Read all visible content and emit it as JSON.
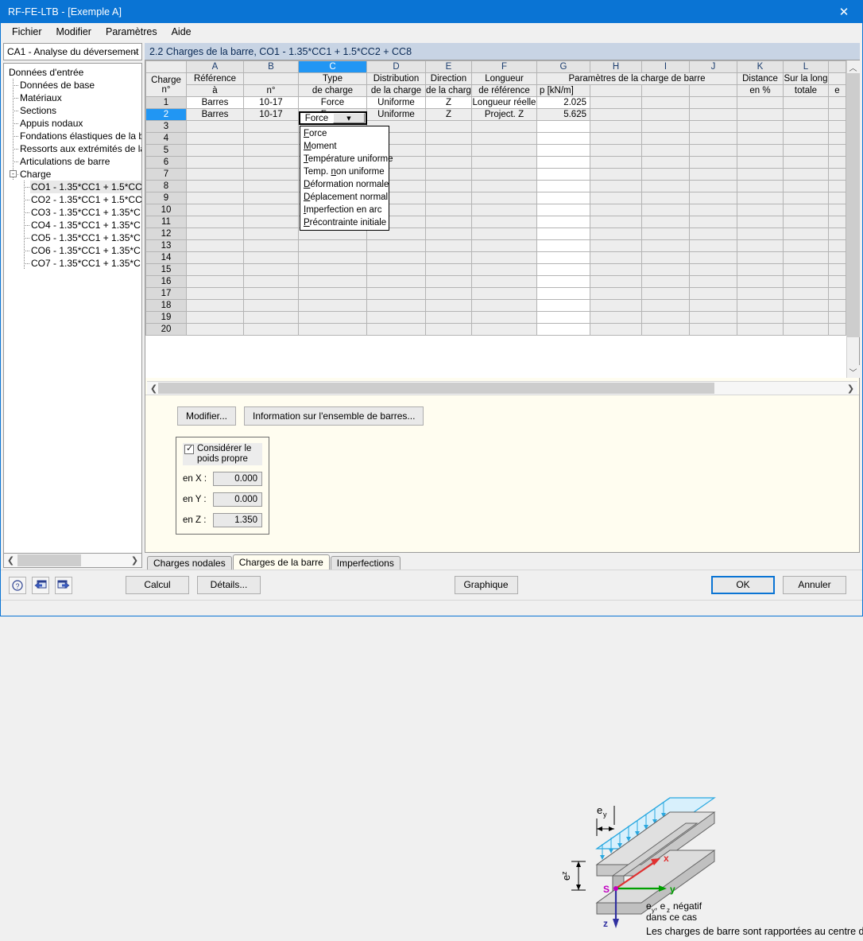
{
  "window": {
    "title": "RF-FE-LTB - [Exemple A]",
    "close_icon": "close-icon"
  },
  "menubar": {
    "items": [
      "Fichier",
      "Modifier",
      "Paramètres",
      "Aide"
    ]
  },
  "sidebar": {
    "combo_value": "CA1 - Analyse du déversement",
    "tree": [
      {
        "label": "Données d'entrée",
        "level": 0
      },
      {
        "label": "Données de base",
        "level": 1
      },
      {
        "label": "Matériaux",
        "level": 1
      },
      {
        "label": "Sections",
        "level": 1
      },
      {
        "label": "Appuis nodaux",
        "level": 1
      },
      {
        "label": "Fondations élastiques de la bar",
        "level": 1
      },
      {
        "label": "Ressorts aux extrémités de la b",
        "level": 1
      },
      {
        "label": "Articulations de barre",
        "level": 1
      },
      {
        "label": "Charge",
        "level": 1,
        "expander": "-"
      },
      {
        "label": "CO1 - 1.35*CC1 + 1.5*CC",
        "level": 2,
        "selected": true
      },
      {
        "label": "CO2 - 1.35*CC1 + 1.5*CC",
        "level": 2
      },
      {
        "label": "CO3 - 1.35*CC1 + 1.35*C",
        "level": 2
      },
      {
        "label": "CO4 - 1.35*CC1 + 1.35*C",
        "level": 2
      },
      {
        "label": "CO5 - 1.35*CC1 + 1.35*C",
        "level": 2
      },
      {
        "label": "CO6 - 1.35*CC1 + 1.35*C",
        "level": 2
      },
      {
        "label": "CO7 - 1.35*CC1 + 1.35*C",
        "level": 2
      }
    ],
    "scroll_left_icon": "chevron-left-icon",
    "scroll_right_icon": "chevron-right-icon"
  },
  "panel": {
    "title": "2.2 Charges de la barre, CO1 - 1.35*CC1 + 1.5*CC2 + CC8"
  },
  "table": {
    "column_letters": [
      "A",
      "B",
      "C",
      "D",
      "E",
      "F",
      "G",
      "H",
      "I",
      "J",
      "K",
      "L"
    ],
    "active_column": "C",
    "row_header_label": "Charge n°",
    "headers": [
      {
        "line1": "Référence",
        "line2": "à"
      },
      {
        "line1": "",
        "line2": "n°"
      },
      {
        "line1": "Type",
        "line2": "de charge"
      },
      {
        "line1": "Distribution",
        "line2": "de la charge"
      },
      {
        "line1": "Direction",
        "line2": "de la charg"
      },
      {
        "line1": "Longueur",
        "line2": "de référence"
      }
    ],
    "group_header": "Paramètres de la charge de barre",
    "group_subheader": "p [kN/m]",
    "headers_right": [
      {
        "line1": "Distance",
        "line2": "en %"
      },
      {
        "line1": "Sur la long",
        "line2": "totale"
      },
      {
        "line1": "",
        "line2": "e"
      }
    ],
    "rows": [
      {
        "n": "1",
        "a": "Barres",
        "b": "10-17",
        "c": "Force",
        "d": "Uniforme",
        "e": "Z",
        "f": "Longueur réelle",
        "g": "2.025",
        "selected": false
      },
      {
        "n": "2",
        "a": "Barres",
        "b": "10-17",
        "c": "Force",
        "d": "Uniforme",
        "e": "Z",
        "f": "Project. Z",
        "g": "5.625",
        "selected": true
      },
      {
        "n": "3"
      },
      {
        "n": "4"
      },
      {
        "n": "5"
      },
      {
        "n": "6"
      },
      {
        "n": "7"
      },
      {
        "n": "8"
      },
      {
        "n": "9"
      },
      {
        "n": "10"
      },
      {
        "n": "11"
      },
      {
        "n": "12"
      },
      {
        "n": "13"
      },
      {
        "n": "14"
      },
      {
        "n": "15"
      },
      {
        "n": "16"
      },
      {
        "n": "17"
      },
      {
        "n": "18"
      },
      {
        "n": "19"
      },
      {
        "n": "20"
      }
    ],
    "scroll_up_icon": "chevron-up-icon",
    "scroll_down_icon": "chevron-down-icon",
    "hscroll_left_icon": "chevron-left-icon",
    "hscroll_right_icon": "chevron-right-icon"
  },
  "dropdown": {
    "selected": "Force",
    "open": true,
    "items": [
      {
        "pre": "",
        "acc": "F",
        "post": "orce"
      },
      {
        "pre": "",
        "acc": "M",
        "post": "oment"
      },
      {
        "pre": "",
        "acc": "T",
        "post": "empérature uniforme"
      },
      {
        "pre": "Temp. ",
        "acc": "n",
        "post": "on uniforme"
      },
      {
        "pre": "",
        "acc": "D",
        "post": "éformation normale"
      },
      {
        "pre": "",
        "acc": "D",
        "post": "éplacement normal"
      },
      {
        "pre": "",
        "acc": "I",
        "post": "mperfection en arc"
      },
      {
        "pre": "",
        "acc": "P",
        "post": "récontrainte initiale"
      }
    ]
  },
  "detail": {
    "buttons": [
      "Modifier...",
      "Information sur l'ensemble de barres..."
    ],
    "selfweight": {
      "checkbox_label_line1": "Considérer le",
      "checkbox_label_line2": "poids propre",
      "checked": true,
      "fields": [
        {
          "label": "en X :",
          "value": "0.000"
        },
        {
          "label": "en Y :",
          "value": "0.000"
        },
        {
          "label": "en Z :",
          "value": "1.350"
        }
      ]
    },
    "diagram": {
      "label_ey": "e",
      "label_ey_sub": "y",
      "label_ez": "e",
      "label_ez_sub": "z",
      "axis_x": "x",
      "axis_y": "y",
      "axis_z": "z",
      "origin": "S",
      "note_line1": "négatif",
      "note_line2": "dans ce cas",
      "note_prefix1": "e",
      "note_sub1": "y",
      "note_prefix2": "e",
      "note_sub2": "z",
      "caption": "Les charges de barre sont rapportées au centre de gravité."
    }
  },
  "tabs": [
    {
      "label": "Charges nodales",
      "active": false
    },
    {
      "label": "Charges de la barre",
      "active": true
    },
    {
      "label": "Imperfections",
      "active": false
    }
  ],
  "footer": {
    "help_icon": "help-icon",
    "prev_icon": "previous-window-icon",
    "next_icon": "next-window-icon",
    "calc_label": "Calcul",
    "details_label": "Détails...",
    "graphic_label": "Graphique",
    "ok_label": "OK",
    "cancel_label": "Annuler"
  },
  "colors": {
    "accent": "#0a74d4",
    "selection": "#2196f3",
    "panel_title_bg": "#c8d4e4",
    "canvas_bg": "#fffdf0",
    "axis_x": "#e03030",
    "axis_y": "#00a000",
    "axis_z": "#3030a0",
    "load_arrow": "#29a8e0",
    "origin": "#c000c0"
  }
}
